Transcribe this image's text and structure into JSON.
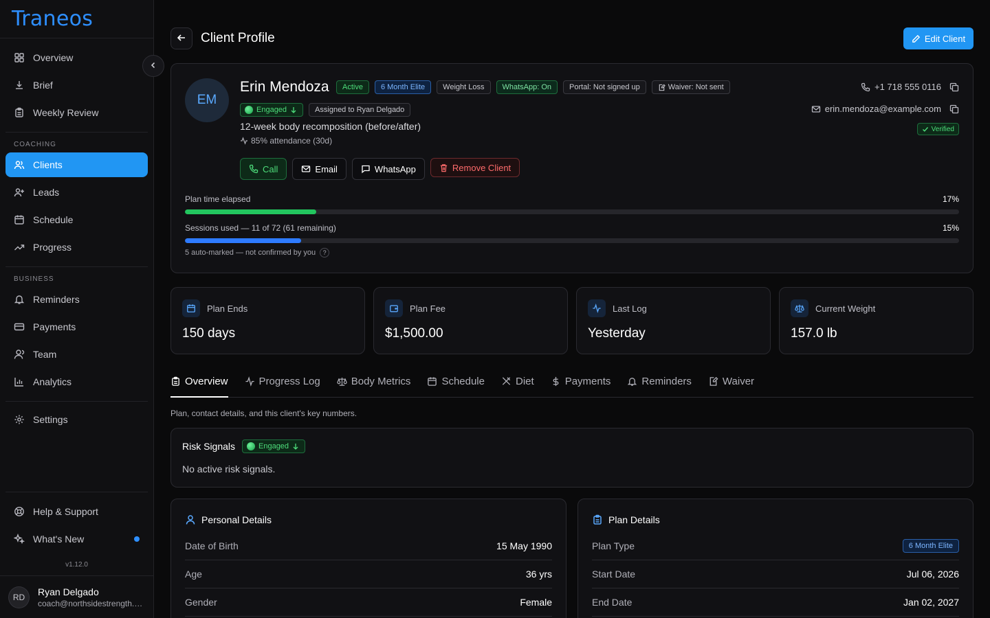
{
  "app": {
    "logo": "Traneos",
    "version": "v1.12.0"
  },
  "sidebar": {
    "top_items": [
      {
        "label": "Overview",
        "icon": "grid-icon"
      },
      {
        "label": "Brief",
        "icon": "brief-icon"
      },
      {
        "label": "Weekly Review",
        "icon": "clipboard-icon"
      }
    ],
    "coaching_label": "COACHING",
    "coaching_items": [
      {
        "label": "Clients",
        "icon": "users-icon",
        "active": true
      },
      {
        "label": "Leads",
        "icon": "user-plus-icon"
      },
      {
        "label": "Schedule",
        "icon": "calendar-icon"
      },
      {
        "label": "Progress",
        "icon": "trending-up-icon"
      }
    ],
    "business_label": "BUSINESS",
    "business_items": [
      {
        "label": "Reminders",
        "icon": "bell-icon"
      },
      {
        "label": "Payments",
        "icon": "card-icon"
      },
      {
        "label": "Team",
        "icon": "team-icon"
      },
      {
        "label": "Analytics",
        "icon": "bar-chart-icon"
      }
    ],
    "settings_label": "Settings",
    "help_label": "Help & Support",
    "whats_new_label": "What's New",
    "user": {
      "initials": "RD",
      "name": "Ryan Delgado",
      "email": "coach@northsidestrength.com"
    }
  },
  "header": {
    "title": "Client Profile",
    "edit_label": "Edit Client"
  },
  "client": {
    "initials": "EM",
    "name": "Erin Mendoza",
    "badges": [
      "Active",
      "6 Month Elite",
      "Weight Loss",
      "WhatsApp: On",
      "Portal: Not signed up",
      "Waiver: Not sent"
    ],
    "engaged_label": "Engaged",
    "assigned_label": "Assigned to Ryan Delgado",
    "goal": "12-week body recomposition (before/after)",
    "attendance": "85% attendance (30d)",
    "phone": "+1 718 555 0116",
    "email": "erin.mendoza@example.com",
    "verified_label": "Verified",
    "actions": {
      "call": "Call",
      "email": "Email",
      "whatsapp": "WhatsApp",
      "remove": "Remove Client"
    }
  },
  "progress": {
    "plan_label": "Plan time elapsed",
    "plan_pct": 17,
    "plan_pct_text": "17%",
    "sessions_label": "Sessions used — 11 of 72 (61 remaining)",
    "sessions_pct": 15,
    "sessions_pct_text": "15%",
    "note": "5 auto-marked — not confirmed by you",
    "colors": {
      "plan": "#22c55e",
      "sessions": "#2e7bff"
    }
  },
  "stats": [
    {
      "label": "Plan Ends",
      "value": "150 days",
      "icon": "calendar-icon"
    },
    {
      "label": "Plan Fee",
      "value": "$1,500.00",
      "icon": "wallet-icon"
    },
    {
      "label": "Last Log",
      "value": "Yesterday",
      "icon": "activity-icon"
    },
    {
      "label": "Current Weight",
      "value": "157.0 lb",
      "icon": "scale-icon"
    }
  ],
  "tabs": [
    {
      "label": "Overview",
      "active": true
    },
    {
      "label": "Progress Log"
    },
    {
      "label": "Body Metrics"
    },
    {
      "label": "Schedule"
    },
    {
      "label": "Diet"
    },
    {
      "label": "Payments"
    },
    {
      "label": "Reminders"
    },
    {
      "label": "Waiver"
    }
  ],
  "tab_description": "Plan, contact details, and this client's key numbers.",
  "risk": {
    "title": "Risk Signals",
    "pill": "Engaged",
    "text": "No active risk signals."
  },
  "personal": {
    "title": "Personal Details",
    "rows": [
      {
        "k": "Date of Birth",
        "v": "15 May 1990"
      },
      {
        "k": "Age",
        "v": "36 yrs"
      },
      {
        "k": "Gender",
        "v": "Female"
      }
    ]
  },
  "plan": {
    "title": "Plan Details",
    "rows": [
      {
        "k": "Plan Type",
        "v": "6 Month Elite"
      },
      {
        "k": "Start Date",
        "v": "Jul 06, 2026"
      },
      {
        "k": "End Date",
        "v": "Jan 02, 2027"
      }
    ]
  }
}
